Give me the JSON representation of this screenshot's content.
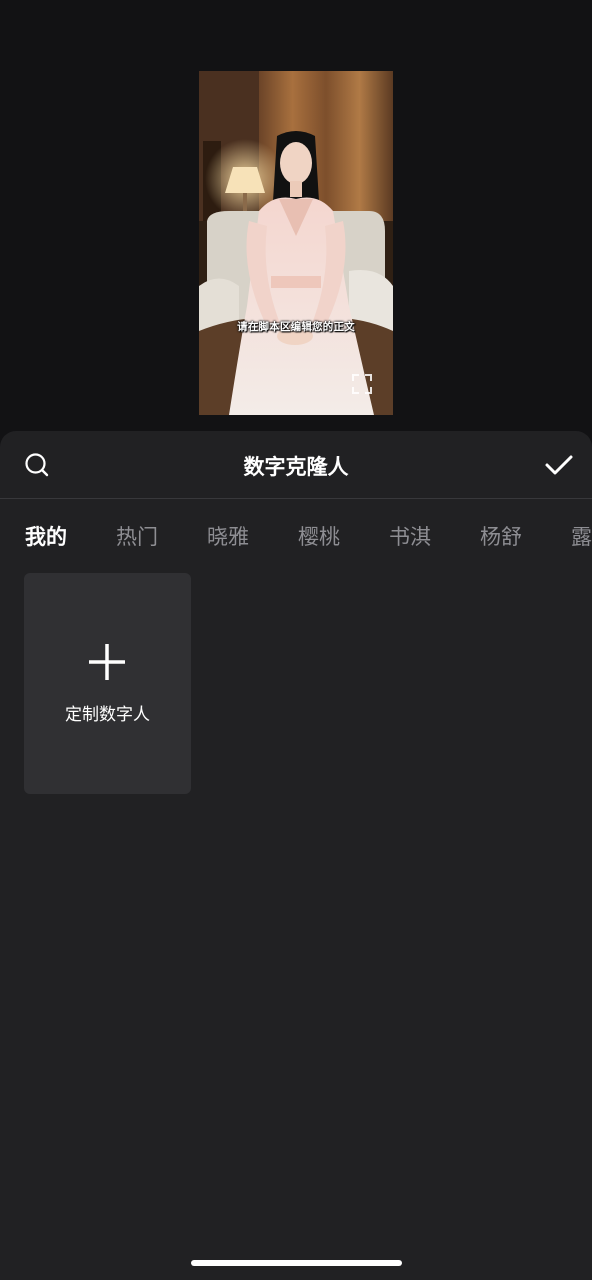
{
  "preview": {
    "subtitle": "请在脚本区编辑您的正文",
    "fullscreen_icon": "fullscreen-icon"
  },
  "header": {
    "title": "数字克隆人",
    "search_icon": "search-icon",
    "confirm_icon": "checkmark-icon"
  },
  "tabs": [
    {
      "label": "我的",
      "active": true
    },
    {
      "label": "热门",
      "active": false
    },
    {
      "label": "晓雅",
      "active": false
    },
    {
      "label": "樱桃",
      "active": false
    },
    {
      "label": "书淇",
      "active": false
    },
    {
      "label": "杨舒",
      "active": false
    },
    {
      "label": "露",
      "active": false
    }
  ],
  "custom_card": {
    "label": "定制数字人",
    "icon": "plus-icon"
  },
  "colors": {
    "background": "#121214",
    "panel": "#212123",
    "card": "#303033",
    "inactive_tab": "#8e8e93"
  }
}
